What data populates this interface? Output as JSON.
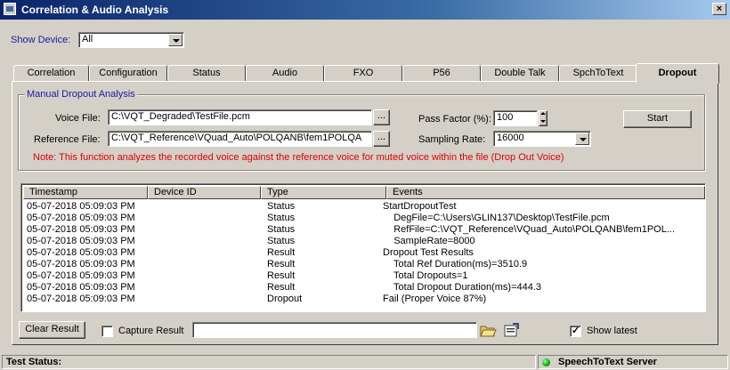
{
  "window": {
    "title": "Correlation &  Audio Analysis",
    "close_label": "×"
  },
  "device": {
    "label": "Show Device:",
    "value": "All"
  },
  "tabs": [
    {
      "label": "Correlation"
    },
    {
      "label": "Configuration"
    },
    {
      "label": "Status"
    },
    {
      "label": "Audio"
    },
    {
      "label": "FXO"
    },
    {
      "label": "P56"
    },
    {
      "label": "Double Talk"
    },
    {
      "label": "SpchToText"
    },
    {
      "label": "Dropout",
      "active": true
    }
  ],
  "manual": {
    "group_title": "Manual Dropout Analysis",
    "voice_file_label": "Voice File:",
    "voice_file_value": "C:\\VQT_Degraded\\TestFile.pcm",
    "reference_file_label": "Reference File:",
    "reference_file_value": "C:\\VQT_Reference\\VQuad_Auto\\POLQANB\\fem1POLQA",
    "browse_label": "...",
    "pass_factor_label": "Pass Factor (%):",
    "pass_factor_value": "100",
    "sampling_rate_label": "Sampling Rate:",
    "sampling_rate_value": "16000",
    "start_label": "Start",
    "note": "Note: This function analyzes the recorded voice against the reference voice for muted voice within the file (Drop Out Voice)"
  },
  "events_table": {
    "columns": [
      "Timestamp",
      "Device ID",
      "Type",
      "Events"
    ],
    "rows": [
      {
        "timestamp": "05-07-2018 05:09:03 PM",
        "device_id": "",
        "type": "Status",
        "event": "StartDropoutTest"
      },
      {
        "timestamp": "05-07-2018 05:09:03 PM",
        "device_id": "",
        "type": "Status",
        "event": "    DegFile=C:\\Users\\GLIN137\\Desktop\\TestFile.pcm"
      },
      {
        "timestamp": "05-07-2018 05:09:03 PM",
        "device_id": "",
        "type": "Status",
        "event": "    RefFile=C:\\VQT_Reference\\VQuad_Auto\\POLQANB\\fem1POL..."
      },
      {
        "timestamp": "05-07-2018 05:09:03 PM",
        "device_id": "",
        "type": "Status",
        "event": "    SampleRate=8000"
      },
      {
        "timestamp": "05-07-2018 05:09:03 PM",
        "device_id": "",
        "type": "Result",
        "event": "Dropout Test Results"
      },
      {
        "timestamp": "05-07-2018 05:09:03 PM",
        "device_id": "",
        "type": "Result",
        "event": "    Total Ref Duration(ms)=3510.9"
      },
      {
        "timestamp": "05-07-2018 05:09:03 PM",
        "device_id": "",
        "type": "Result",
        "event": "    Total Dropouts=1"
      },
      {
        "timestamp": "05-07-2018 05:09:03 PM",
        "device_id": "",
        "type": "Result",
        "event": "    Total Dropout Duration(ms)=444.3"
      },
      {
        "timestamp": "05-07-2018 05:09:03 PM",
        "device_id": "",
        "type": "Dropout",
        "event": "Fail (Proper Voice 87%)"
      }
    ]
  },
  "bottom": {
    "clear_result_label": "Clear Result",
    "capture_result_label": "Capture Result",
    "capture_result_checked": false,
    "capture_path_value": "",
    "show_latest_label": "Show latest",
    "show_latest_checked": true
  },
  "statusbar": {
    "left": "Test Status:",
    "right": "SpeechToText Server"
  },
  "colors": {
    "title_start": "#0a246a",
    "title_end": "#a6caf0",
    "note": "#e00000",
    "link_blue": "#1a1aa0",
    "server_ok": "#00aa00"
  },
  "icons": {
    "open_folder": "open-folder-icon",
    "export": "export-icon"
  }
}
